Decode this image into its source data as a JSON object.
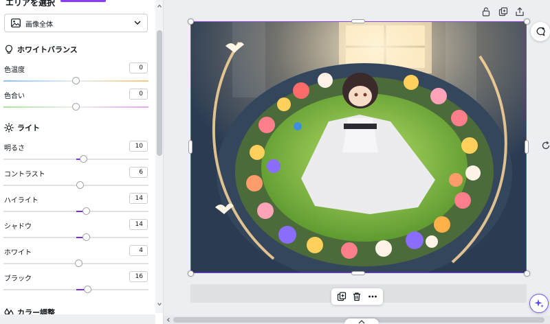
{
  "panel": {
    "area_heading": "エリアを選択",
    "area_select_value": "画像全体",
    "white_balance": {
      "title": "ホワイトバランス",
      "items": [
        {
          "label": "色温度",
          "value": "0",
          "level": 0
        },
        {
          "label": "色合い",
          "value": "0",
          "level": 0
        }
      ]
    },
    "light": {
      "title": "ライト",
      "items": [
        {
          "label": "明るさ",
          "value": "10",
          "level": 10
        },
        {
          "label": "コントラスト",
          "value": "6",
          "level": 6
        },
        {
          "label": "ハイライト",
          "value": "14",
          "level": 14
        },
        {
          "label": "シャドウ",
          "value": "14",
          "level": 14
        },
        {
          "label": "ホワイト",
          "value": "4",
          "level": 4
        },
        {
          "label": "ブラック",
          "value": "16",
          "level": 16
        }
      ]
    },
    "next_section_title": "カラー調整"
  },
  "slider_range": [
    -100,
    100
  ],
  "colors": {
    "accent": "#8b3dff",
    "slider_fill": "#7d2ae8"
  },
  "icons": {
    "lock": "lock-icon",
    "duplicate": "duplicate-icon",
    "share": "share-icon",
    "comment": "comment-add-icon",
    "rotate": "rotate-icon",
    "magic": "sparkle-icon",
    "copy_page": "copy-icon",
    "delete": "trash-icon",
    "more": "more-icon"
  }
}
